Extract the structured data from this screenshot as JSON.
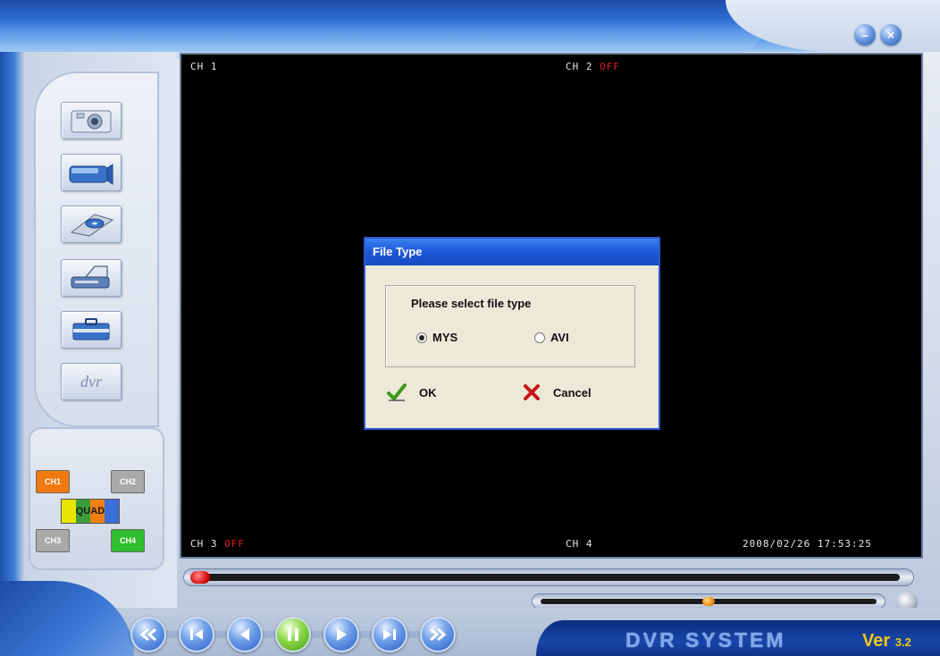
{
  "app": {
    "brand": "DVR SYSTEM",
    "version_label": "Ver",
    "version_number": "3.2"
  },
  "window_controls": {
    "minimize_glyph": "–",
    "close_glyph": "×"
  },
  "channels": {
    "ch1": {
      "label": "CH 1",
      "status": ""
    },
    "ch2": {
      "label": "CH 2",
      "status": "OFF"
    },
    "ch3": {
      "label": "CH 3",
      "status": "OFF"
    },
    "ch4": {
      "label": "CH 4",
      "status": ""
    }
  },
  "timestamp": "2008/02/26 17:53:25",
  "side_tools": [
    "camera-icon",
    "camcorder-icon",
    "disc-icon",
    "printer-icon",
    "briefcase-icon",
    "dvr-logo-icon"
  ],
  "side_tools_dvr_glyph": "dvr",
  "channel_buttons": {
    "ch1": {
      "label": "CH1",
      "color": "#f07a10"
    },
    "ch2": {
      "label": "CH2",
      "color": "#a9a9a9"
    },
    "ch3": {
      "label": "CH3",
      "color": "#a9a9a9"
    },
    "ch4": {
      "label": "CH4",
      "color": "#2fbf2f"
    },
    "quad": {
      "label": "QUAD"
    }
  },
  "dialog": {
    "title": "File Type",
    "prompt": "Please select file type",
    "options": [
      {
        "label": "MYS",
        "selected": true
      },
      {
        "label": "AVI",
        "selected": false
      }
    ],
    "ok_label": "OK",
    "cancel_label": "Cancel"
  },
  "playback": {
    "position_fraction": 0.0,
    "volume_fraction": 0.5,
    "buttons": [
      "fast-rewind-icon",
      "skip-back-icon",
      "step-back-icon",
      "pause-icon",
      "play-icon",
      "step-forward-icon",
      "fast-forward-icon"
    ]
  },
  "colors": {
    "title_bar": "#2f6fd6",
    "off_status": "#e02020",
    "version_text": "#f2c811",
    "dialog_title": "#1d56d8"
  }
}
